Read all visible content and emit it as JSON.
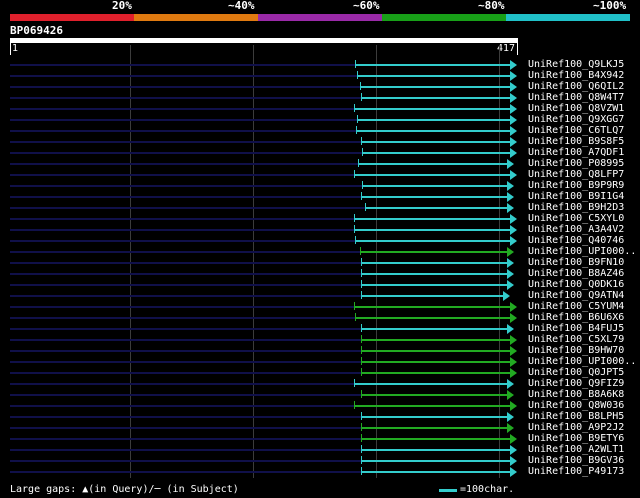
{
  "colors": {
    "band_red": "#e0202c",
    "band_orange": "#e07a10",
    "band_purple": "#9a2aa8",
    "band_green": "#18a018",
    "band_cyan": "#20c0c8",
    "hit_cyan": "#33cccc",
    "hit_green": "#22aa22"
  },
  "header": {
    "percent_labels": [
      "20%",
      "~40%",
      "~60%",
      "~80%",
      "~100%"
    ]
  },
  "query": {
    "name": "BP069426",
    "start": "1",
    "end": "417"
  },
  "hits": [
    {
      "label": "UniRef100_Q9LKJ5",
      "color": "cyan"
    },
    {
      "label": "UniRef100_B4X942",
      "color": "cyan"
    },
    {
      "label": "UniRef100_Q6QIL2",
      "color": "cyan"
    },
    {
      "label": "UniRef100_Q8W4T7",
      "color": "cyan"
    },
    {
      "label": "UniRef100_Q8VZW1",
      "color": "cyan"
    },
    {
      "label": "UniRef100_Q9XGG7",
      "color": "cyan"
    },
    {
      "label": "UniRef100_C6TLQ7",
      "color": "cyan"
    },
    {
      "label": "UniRef100_B9S8F5",
      "color": "cyan"
    },
    {
      "label": "UniRef100_A7QDF1",
      "color": "cyan"
    },
    {
      "label": "UniRef100_P08995",
      "color": "cyan"
    },
    {
      "label": "UniRef100_Q8LFP7",
      "color": "cyan"
    },
    {
      "label": "UniRef100_B9P9R9",
      "color": "cyan"
    },
    {
      "label": "UniRef100_B9I1G4",
      "color": "cyan"
    },
    {
      "label": "UniRef100_B9H2D3",
      "color": "cyan"
    },
    {
      "label": "UniRef100_C5XYL0",
      "color": "cyan"
    },
    {
      "label": "UniRef100_A3A4V2",
      "color": "cyan"
    },
    {
      "label": "UniRef100_Q40746",
      "color": "cyan"
    },
    {
      "label": "UniRef100_UPI000..",
      "color": "green"
    },
    {
      "label": "UniRef100_B9FN10",
      "color": "cyan"
    },
    {
      "label": "UniRef100_B8AZ46",
      "color": "cyan"
    },
    {
      "label": "UniRef100_Q0DK16",
      "color": "cyan"
    },
    {
      "label": "UniRef100_Q9ATN4",
      "color": "cyan"
    },
    {
      "label": "UniRef100_C5YUM4",
      "color": "green"
    },
    {
      "label": "UniRef100_B6U6X6",
      "color": "green"
    },
    {
      "label": "UniRef100_B4FUJ5",
      "color": "cyan"
    },
    {
      "label": "UniRef100_C5XL79",
      "color": "green"
    },
    {
      "label": "UniRef100_B9HW70",
      "color": "green"
    },
    {
      "label": "UniRef100_UPI000..",
      "color": "green"
    },
    {
      "label": "UniRef100_Q0JPT5",
      "color": "green"
    },
    {
      "label": "UniRef100_Q9FIZ9",
      "color": "cyan"
    },
    {
      "label": "UniRef100_B8A6K8",
      "color": "green"
    },
    {
      "label": "UniRef100_Q8W036",
      "color": "green"
    },
    {
      "label": "UniRef100_B8LPH5",
      "color": "cyan"
    },
    {
      "label": "UniRef100_A9P2J2",
      "color": "green"
    },
    {
      "label": "UniRef100_B9ETY6",
      "color": "green"
    },
    {
      "label": "UniRef100_A2WLT1",
      "color": "cyan"
    },
    {
      "label": "UniRef100_B9GV36",
      "color": "cyan"
    },
    {
      "label": "UniRef100_P49173",
      "color": "cyan"
    }
  ],
  "legend": {
    "gaps_text": "Large gaps: ▲(in Query)/─ (in Subject)",
    "scale_text": "=100char."
  }
}
